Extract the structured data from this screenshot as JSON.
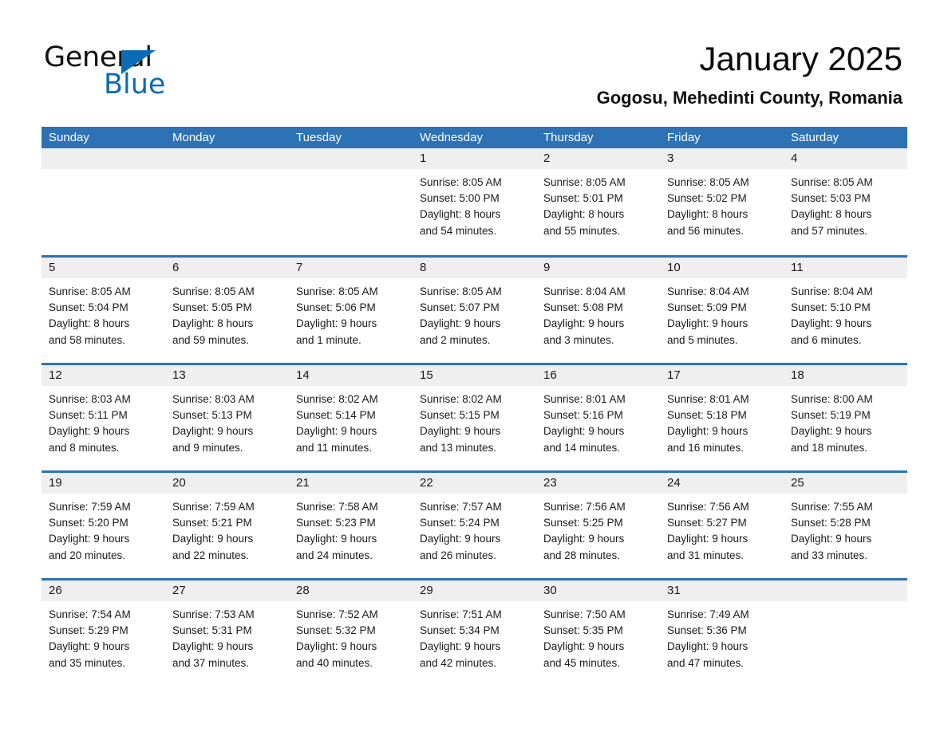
{
  "brand": {
    "name_part1": "General",
    "name_part2": "Blue",
    "logo_icon": "triangle-flag-icon",
    "accent_color": "#0b6cb5"
  },
  "header": {
    "title": "January 2025",
    "subtitle": "Gogosu, Mehedinti County, Romania"
  },
  "colors": {
    "header_blue": "#2d72b5",
    "daynum_band": "#efefef",
    "text": "#1a1a1a"
  },
  "calendar": {
    "weekdays": [
      "Sunday",
      "Monday",
      "Tuesday",
      "Wednesday",
      "Thursday",
      "Friday",
      "Saturday"
    ],
    "weeks": [
      [
        {
          "day": "",
          "lines": []
        },
        {
          "day": "",
          "lines": []
        },
        {
          "day": "",
          "lines": []
        },
        {
          "day": "1",
          "lines": [
            "Sunrise: 8:05 AM",
            "Sunset: 5:00 PM",
            "Daylight: 8 hours",
            "and 54 minutes."
          ]
        },
        {
          "day": "2",
          "lines": [
            "Sunrise: 8:05 AM",
            "Sunset: 5:01 PM",
            "Daylight: 8 hours",
            "and 55 minutes."
          ]
        },
        {
          "day": "3",
          "lines": [
            "Sunrise: 8:05 AM",
            "Sunset: 5:02 PM",
            "Daylight: 8 hours",
            "and 56 minutes."
          ]
        },
        {
          "day": "4",
          "lines": [
            "Sunrise: 8:05 AM",
            "Sunset: 5:03 PM",
            "Daylight: 8 hours",
            "and 57 minutes."
          ]
        }
      ],
      [
        {
          "day": "5",
          "lines": [
            "Sunrise: 8:05 AM",
            "Sunset: 5:04 PM",
            "Daylight: 8 hours",
            "and 58 minutes."
          ]
        },
        {
          "day": "6",
          "lines": [
            "Sunrise: 8:05 AM",
            "Sunset: 5:05 PM",
            "Daylight: 8 hours",
            "and 59 minutes."
          ]
        },
        {
          "day": "7",
          "lines": [
            "Sunrise: 8:05 AM",
            "Sunset: 5:06 PM",
            "Daylight: 9 hours",
            "and 1 minute."
          ]
        },
        {
          "day": "8",
          "lines": [
            "Sunrise: 8:05 AM",
            "Sunset: 5:07 PM",
            "Daylight: 9 hours",
            "and 2 minutes."
          ]
        },
        {
          "day": "9",
          "lines": [
            "Sunrise: 8:04 AM",
            "Sunset: 5:08 PM",
            "Daylight: 9 hours",
            "and 3 minutes."
          ]
        },
        {
          "day": "10",
          "lines": [
            "Sunrise: 8:04 AM",
            "Sunset: 5:09 PM",
            "Daylight: 9 hours",
            "and 5 minutes."
          ]
        },
        {
          "day": "11",
          "lines": [
            "Sunrise: 8:04 AM",
            "Sunset: 5:10 PM",
            "Daylight: 9 hours",
            "and 6 minutes."
          ]
        }
      ],
      [
        {
          "day": "12",
          "lines": [
            "Sunrise: 8:03 AM",
            "Sunset: 5:11 PM",
            "Daylight: 9 hours",
            "and 8 minutes."
          ]
        },
        {
          "day": "13",
          "lines": [
            "Sunrise: 8:03 AM",
            "Sunset: 5:13 PM",
            "Daylight: 9 hours",
            "and 9 minutes."
          ]
        },
        {
          "day": "14",
          "lines": [
            "Sunrise: 8:02 AM",
            "Sunset: 5:14 PM",
            "Daylight: 9 hours",
            "and 11 minutes."
          ]
        },
        {
          "day": "15",
          "lines": [
            "Sunrise: 8:02 AM",
            "Sunset: 5:15 PM",
            "Daylight: 9 hours",
            "and 13 minutes."
          ]
        },
        {
          "day": "16",
          "lines": [
            "Sunrise: 8:01 AM",
            "Sunset: 5:16 PM",
            "Daylight: 9 hours",
            "and 14 minutes."
          ]
        },
        {
          "day": "17",
          "lines": [
            "Sunrise: 8:01 AM",
            "Sunset: 5:18 PM",
            "Daylight: 9 hours",
            "and 16 minutes."
          ]
        },
        {
          "day": "18",
          "lines": [
            "Sunrise: 8:00 AM",
            "Sunset: 5:19 PM",
            "Daylight: 9 hours",
            "and 18 minutes."
          ]
        }
      ],
      [
        {
          "day": "19",
          "lines": [
            "Sunrise: 7:59 AM",
            "Sunset: 5:20 PM",
            "Daylight: 9 hours",
            "and 20 minutes."
          ]
        },
        {
          "day": "20",
          "lines": [
            "Sunrise: 7:59 AM",
            "Sunset: 5:21 PM",
            "Daylight: 9 hours",
            "and 22 minutes."
          ]
        },
        {
          "day": "21",
          "lines": [
            "Sunrise: 7:58 AM",
            "Sunset: 5:23 PM",
            "Daylight: 9 hours",
            "and 24 minutes."
          ]
        },
        {
          "day": "22",
          "lines": [
            "Sunrise: 7:57 AM",
            "Sunset: 5:24 PM",
            "Daylight: 9 hours",
            "and 26 minutes."
          ]
        },
        {
          "day": "23",
          "lines": [
            "Sunrise: 7:56 AM",
            "Sunset: 5:25 PM",
            "Daylight: 9 hours",
            "and 28 minutes."
          ]
        },
        {
          "day": "24",
          "lines": [
            "Sunrise: 7:56 AM",
            "Sunset: 5:27 PM",
            "Daylight: 9 hours",
            "and 31 minutes."
          ]
        },
        {
          "day": "25",
          "lines": [
            "Sunrise: 7:55 AM",
            "Sunset: 5:28 PM",
            "Daylight: 9 hours",
            "and 33 minutes."
          ]
        }
      ],
      [
        {
          "day": "26",
          "lines": [
            "Sunrise: 7:54 AM",
            "Sunset: 5:29 PM",
            "Daylight: 9 hours",
            "and 35 minutes."
          ]
        },
        {
          "day": "27",
          "lines": [
            "Sunrise: 7:53 AM",
            "Sunset: 5:31 PM",
            "Daylight: 9 hours",
            "and 37 minutes."
          ]
        },
        {
          "day": "28",
          "lines": [
            "Sunrise: 7:52 AM",
            "Sunset: 5:32 PM",
            "Daylight: 9 hours",
            "and 40 minutes."
          ]
        },
        {
          "day": "29",
          "lines": [
            "Sunrise: 7:51 AM",
            "Sunset: 5:34 PM",
            "Daylight: 9 hours",
            "and 42 minutes."
          ]
        },
        {
          "day": "30",
          "lines": [
            "Sunrise: 7:50 AM",
            "Sunset: 5:35 PM",
            "Daylight: 9 hours",
            "and 45 minutes."
          ]
        },
        {
          "day": "31",
          "lines": [
            "Sunrise: 7:49 AM",
            "Sunset: 5:36 PM",
            "Daylight: 9 hours",
            "and 47 minutes."
          ]
        },
        {
          "day": "",
          "lines": []
        }
      ]
    ]
  }
}
